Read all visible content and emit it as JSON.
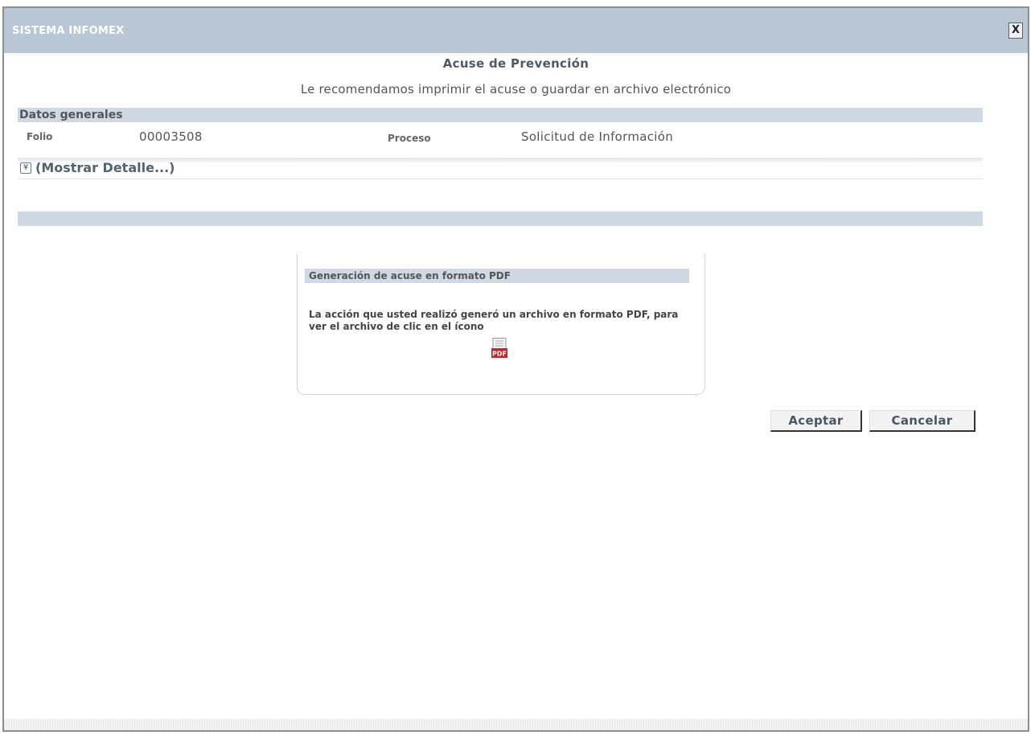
{
  "window": {
    "title": "SISTEMA INFOMEX",
    "close_label": "X"
  },
  "header": {
    "title": "Acuse de Prevención",
    "subtitle": "Le recomendamos imprimir el acuse o guardar en archivo electrónico"
  },
  "general": {
    "section_label": "Datos generales",
    "folio_label": "Folio",
    "folio_value": "00003508",
    "proceso_label": "Proceso",
    "proceso_value": "Solicitud de Información",
    "show_detail": "(Mostrar Detalle...)"
  },
  "pdf_panel": {
    "title": "Generación de acuse en formato PDF",
    "message": "La acción que usted realizó generó un archivo en formato PDF, para ver el archivo de clic en el ícono",
    "icon": "pdf-icon",
    "icon_text": "PDF"
  },
  "buttons": {
    "accept": "Aceptar",
    "cancel": "Cancelar"
  },
  "colors": {
    "titlebar": "#b9c6d4",
    "section": "#cfd9e3",
    "pdf_red": "#c0282d"
  }
}
